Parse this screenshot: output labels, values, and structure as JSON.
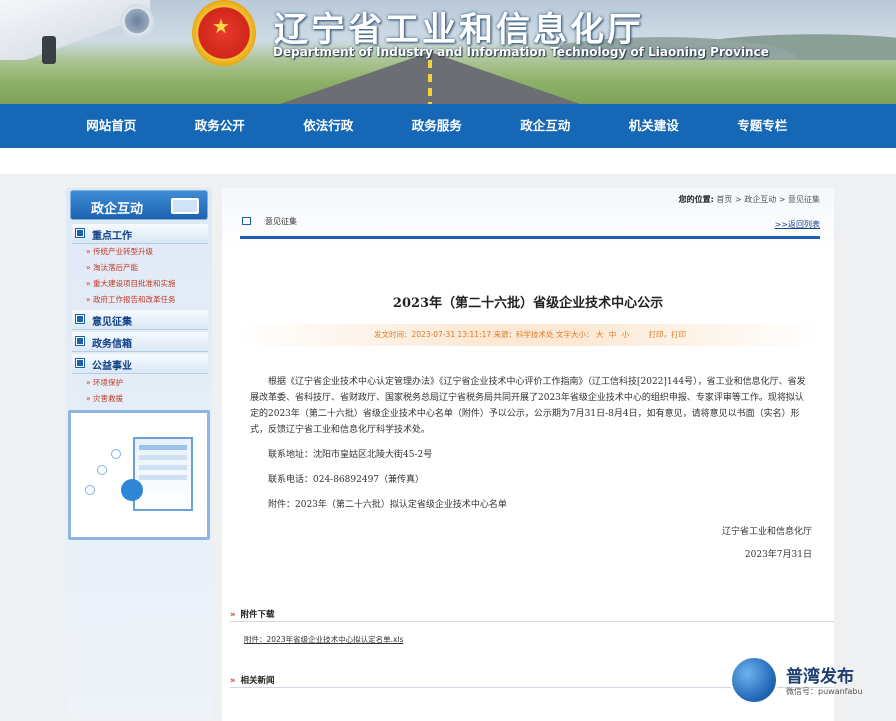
{
  "header": {
    "title": "辽宁省工业和信息化厅",
    "subtitle": "Department of Industry and Information Technology of Liaoning Province"
  },
  "nav": [
    "网站首页",
    "政务公开",
    "依法行政",
    "政务服务",
    "政企互动",
    "机关建设",
    "专题专栏"
  ],
  "sidebar": {
    "title": "政企互动",
    "sections": [
      {
        "label": "重点工作",
        "items": [
          "传统产业转型升级",
          "淘汰落后产能",
          "重大建设项目批准和实施",
          "政府工作报告和改革任务"
        ]
      },
      {
        "label": "意见征集",
        "items": []
      },
      {
        "label": "政务信箱",
        "items": []
      },
      {
        "label": "公益事业",
        "items": [
          "环境保护",
          "灾害救援"
        ]
      }
    ]
  },
  "breadcrumb": {
    "label": "您的位置:",
    "path": "首页 > 政企互动 > 意见征集"
  },
  "tab_label": "意见征集",
  "back_link": ">>返回列表",
  "article": {
    "title": "2023年（第二十六批）省级企业技术中心公示",
    "meta": "发文时间：2023-07-31 13:11:17  来源：科学技术处  文字大小：",
    "font_sizes": [
      "大",
      "中",
      "小"
    ],
    "print": "打印",
    "print2": "打印",
    "paragraphs": [
      "根据《辽宁省企业技术中心认定管理办法》《辽宁省企业技术中心评价工作指南》（辽工信科技[2022]144号），省工业和信息化厅、省发展改革委、省科技厅、省财政厅、国家税务总局辽宁省税务局共同开展了2023年省级企业技术中心的组织申报、专家评审等工作。现将拟认定的2023年（第二十六批）省级企业技术中心名单（附件）予以公示，公示期为7月31日-8月4日，如有意见，请将意见以书面（实名）形式，反馈辽宁省工业和信息化厅科学技术处。",
      "联系地址：沈阳市皇姑区北陵大街45-2号",
      "联系电话：024-86892497（兼传真）",
      "附件：2023年（第二十六批）拟认定省级企业技术中心名单"
    ],
    "signature": "辽宁省工业和信息化厅",
    "date": "2023年7月31日"
  },
  "attachments": {
    "heading": "附件下载",
    "file": "附件：2023年省级企业技术中心拟认定名单.xls"
  },
  "related": {
    "heading": "相关新闻"
  },
  "watermark": {
    "brand": "普湾发布",
    "account": "微信号：puwanfabu"
  },
  "colors": {
    "nav": "#1667b5",
    "accent": "#c0392b",
    "meta": "#e07a20"
  }
}
